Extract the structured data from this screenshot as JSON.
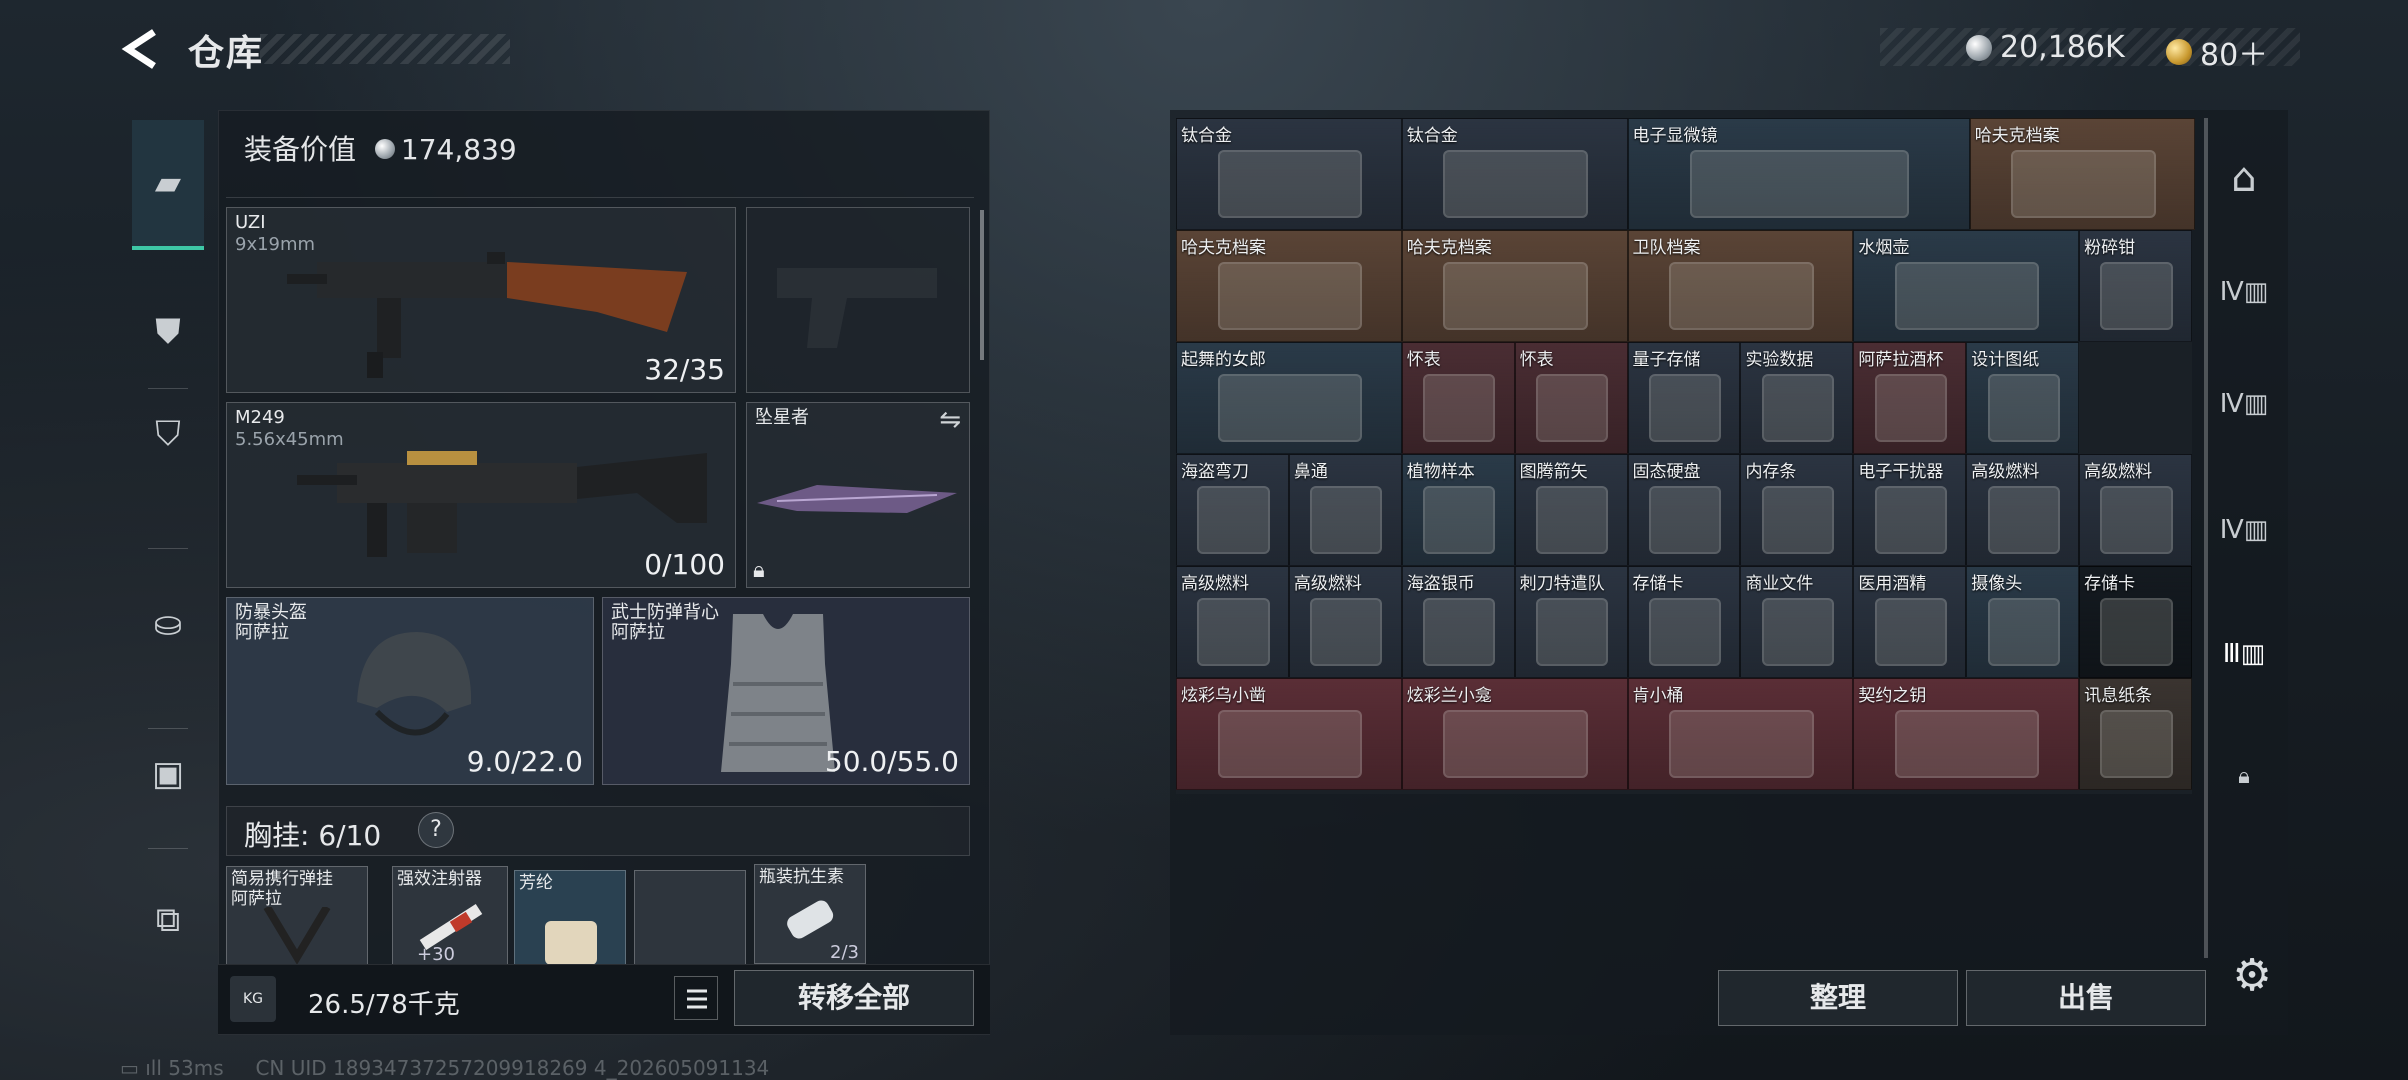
{
  "header": {
    "title": "仓库",
    "silver": "20,186K",
    "gold": "80＋"
  },
  "equipment": {
    "value_label": "装备价值",
    "value": "174,839",
    "primary": {
      "name": "UZI",
      "ammo": "9x19mm",
      "count": "32/35"
    },
    "secondary": {
      "name": "M249",
      "ammo": "5.56x45mm",
      "count": "0/100"
    },
    "melee": {
      "name": "坠星者"
    },
    "helmet": {
      "name": "防暴头盔",
      "brand": "阿萨拉",
      "durability": "9.0/22.0"
    },
    "armor": {
      "name": "武士防弹背心",
      "brand": "阿萨拉",
      "durability": "50.0/55.0"
    },
    "chest": {
      "label": "胸挂:",
      "count": "6/10",
      "help": "?"
    },
    "chest_items": [
      {
        "name": "简易携行弹挂",
        "sub": "阿萨拉"
      },
      {
        "name": "强效注射器",
        "sub": "",
        "count": "+30"
      },
      {
        "name": "芳纶",
        "sub": ""
      },
      {
        "name": "",
        "sub": ""
      },
      {
        "name": "瓶装抗生素",
        "sub": "",
        "count": "2/3"
      }
    ]
  },
  "footer_bar": {
    "kg": "KG",
    "weight": "26.5/78千克",
    "transfer": "转移全部"
  },
  "stash": {
    "items": [
      {
        "label": "钛合金",
        "color": "#2b3441"
      },
      {
        "label": "钛合金",
        "color": "#2b3441"
      },
      {
        "label": "电子显微镜",
        "color": "#2a3a48"
      },
      {
        "label": "哈夫克档案",
        "color": "#5a4436"
      },
      {
        "label": "哈夫克档案",
        "color": "#5a4436"
      },
      {
        "label": "哈夫克档案",
        "color": "#5a4436"
      },
      {
        "label": "卫队档案",
        "color": "#5a4436"
      },
      {
        "label": "水烟壶",
        "color": "#2a3a48"
      },
      {
        "label": "粉碎钳",
        "color": "#2b3441"
      },
      {
        "label": "起舞的女郎",
        "color": "#2a3a48"
      },
      {
        "label": "怀表",
        "color": "#4a2d33"
      },
      {
        "label": "怀表",
        "color": "#4a2d33"
      },
      {
        "label": "量子存储",
        "color": "#2b3441"
      },
      {
        "label": "实验数据",
        "color": "#2b3441"
      },
      {
        "label": "阿萨拉酒杯",
        "color": "#4a2d33"
      },
      {
        "label": "设计图纸",
        "color": "#2a3a48"
      },
      {
        "label": "海盗弯刀",
        "color": "#2b3441"
      },
      {
        "label": "鼻通",
        "color": "#2b3441"
      },
      {
        "label": "植物样本",
        "color": "#2a3a48"
      },
      {
        "label": "图腾箭矢",
        "color": "#2b3441"
      },
      {
        "label": "固态硬盘",
        "color": "#2b3441"
      },
      {
        "label": "内存条",
        "color": "#2b3441"
      },
      {
        "label": "电子干扰器",
        "color": "#2b3441"
      },
      {
        "label": "高级燃料",
        "color": "#2b3441"
      },
      {
        "label": "高级燃料",
        "color": "#2b3441"
      },
      {
        "label": "高级燃料",
        "color": "#2b3441"
      },
      {
        "label": "高级燃料",
        "color": "#2b3441"
      },
      {
        "label": "海盗银币",
        "color": "#2b3441"
      },
      {
        "label": "刺刀特遣队",
        "color": "#2b3441"
      },
      {
        "label": "存储卡",
        "color": "#2b3441"
      },
      {
        "label": "商业文件",
        "color": "#2b3441"
      },
      {
        "label": "医用酒精",
        "color": "#2b3441"
      },
      {
        "label": "摄像头",
        "color": "#2a3a48"
      },
      {
        "label": "存储卡",
        "color": "#141a20"
      },
      {
        "label": "炫彩乌小凿",
        "color": "#5a2e36"
      },
      {
        "label": "炫彩兰小龛",
        "color": "#5a2e36"
      },
      {
        "label": "肯小桶",
        "color": "#5a2e36"
      },
      {
        "label": "契约之钥",
        "color": "#5a2e36"
      },
      {
        "label": "讯息纸条",
        "color": "#3a3430"
      }
    ],
    "sort_button": "整理",
    "sell_button": "出售"
  },
  "status": {
    "ping": "53ms",
    "uid": "CN UID 18934737257209918269 4_202605091134"
  }
}
